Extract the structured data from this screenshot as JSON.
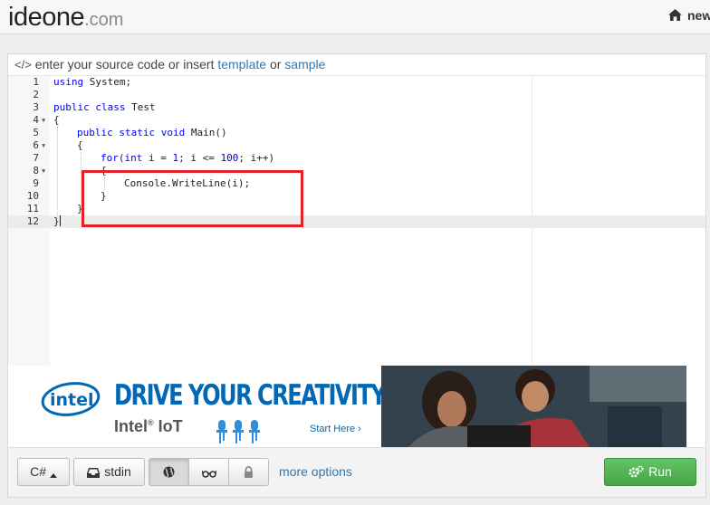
{
  "header": {
    "logo_main": "ideone",
    "logo_domain": ".com",
    "nav_new": "new",
    "icon": "home-icon"
  },
  "editor": {
    "head_prefix": "enter your source code or insert",
    "head_link_template": "template",
    "head_or": "or",
    "head_link_sample": "sample",
    "icon": "code-icon",
    "active_line": 12,
    "lines": [
      {
        "n": "1",
        "fold": false
      },
      {
        "n": "2",
        "fold": false
      },
      {
        "n": "3",
        "fold": false
      },
      {
        "n": "4",
        "fold": true
      },
      {
        "n": "5",
        "fold": false
      },
      {
        "n": "6",
        "fold": true
      },
      {
        "n": "7",
        "fold": false
      },
      {
        "n": "8",
        "fold": true
      },
      {
        "n": "9",
        "fold": false
      },
      {
        "n": "10",
        "fold": false
      },
      {
        "n": "11",
        "fold": false
      },
      {
        "n": "12",
        "fold": false
      }
    ],
    "code": {
      "l1_kw": "using",
      "l1_rest": " System;",
      "l3_kw1": "public",
      "l3_kw2": "class",
      "l3_rest": " Test",
      "l4": "{",
      "l5_kw1": "public",
      "l5_kw2": "static",
      "l5_kw3": "void",
      "l5_rest": " Main()",
      "l6": "{",
      "l7_for": "for",
      "l7_a": "(",
      "l7_int": "int",
      "l7_b": " i = ",
      "l7_one": "1",
      "l7_c": "; i <= ",
      "l7_hundred": "100",
      "l7_d": "; i++)",
      "l8": "{",
      "l9": "Console.WriteLine(i);",
      "l10": "}",
      "l11": "}",
      "l12": "}"
    }
  },
  "ad": {
    "brand": "intel",
    "headline": "DRIVE YOUR CREATIVITY",
    "sub_a": "Intel",
    "sub_reg": "®",
    "sub_b": " IoT",
    "cta": "Start Here ›"
  },
  "toolbar": {
    "language": "C#",
    "stdin": "stdin",
    "more_options": "more options",
    "run": "Run",
    "icons": [
      "caret-up-icon",
      "inbox-icon",
      "globe-icon",
      "glasses-icon",
      "lock-icon",
      "gears-icon"
    ]
  },
  "colors": {
    "link": "#2a7ab8",
    "keyword": "#0000ff",
    "highlight_box": "#e32227",
    "run_button": "#5cb85c",
    "intel_blue": "#0068b5"
  }
}
